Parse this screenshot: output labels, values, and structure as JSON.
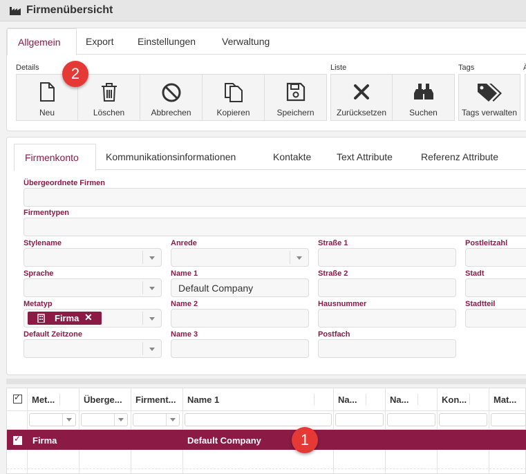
{
  "window": {
    "title": "Firmenübersicht",
    "icon": "factory-icon"
  },
  "ribbon": {
    "tabs": [
      "Allgemein",
      "Export",
      "Einstellungen",
      "Verwaltung"
    ],
    "active_tab": "Allgemein",
    "groups": {
      "details": "Details",
      "liste": "Liste",
      "tags": "Tags"
    },
    "buttons": {
      "neu": "Neu",
      "loeschen": "Löschen",
      "abbrechen": "Abbrechen",
      "kopieren": "Kopieren",
      "speichern": "Speichern",
      "zuruecksetzen": "Zurücksetzen",
      "suchen": "Suchen",
      "tags_verwalten": "Tags verwalten"
    }
  },
  "form": {
    "tabs": [
      "Firmenkonto",
      "Kommunikationsinformationen",
      "Kontakte",
      "Text Attribute",
      "Referenz Attribute"
    ],
    "active_tab": "Firmenkonto",
    "labels": {
      "uebergeordnete": "Übergeordnete Firmen",
      "firmentypen": "Firmentypen",
      "stylename": "Stylename",
      "anrede": "Anrede",
      "strasse1": "Straße 1",
      "plz": "Postleitzahl",
      "sprache": "Sprache",
      "name1": "Name 1",
      "strasse2": "Straße 2",
      "stadt": "Stadt",
      "metatyp": "Metatyp",
      "name2": "Name 2",
      "hausnummer": "Hausnummer",
      "stadtteil": "Stadtteil",
      "zeitzone": "Default Zeitzone",
      "name3": "Name 3",
      "postfach": "Postfach"
    },
    "values": {
      "name1": "Default Company",
      "metatyp_chip": "Firma"
    }
  },
  "grid": {
    "columns": [
      "Met...",
      "Überge...",
      "Firment...",
      "Name 1",
      "Na...",
      "Na...",
      "Kon...",
      "Mat..."
    ],
    "rows": [
      {
        "metatyp": "Firma",
        "name1": "Default Company",
        "checked": true
      }
    ]
  },
  "badges": {
    "first": "1",
    "second": "2"
  },
  "colors": {
    "accent": "#8b1a45",
    "badge": "#e53935"
  }
}
